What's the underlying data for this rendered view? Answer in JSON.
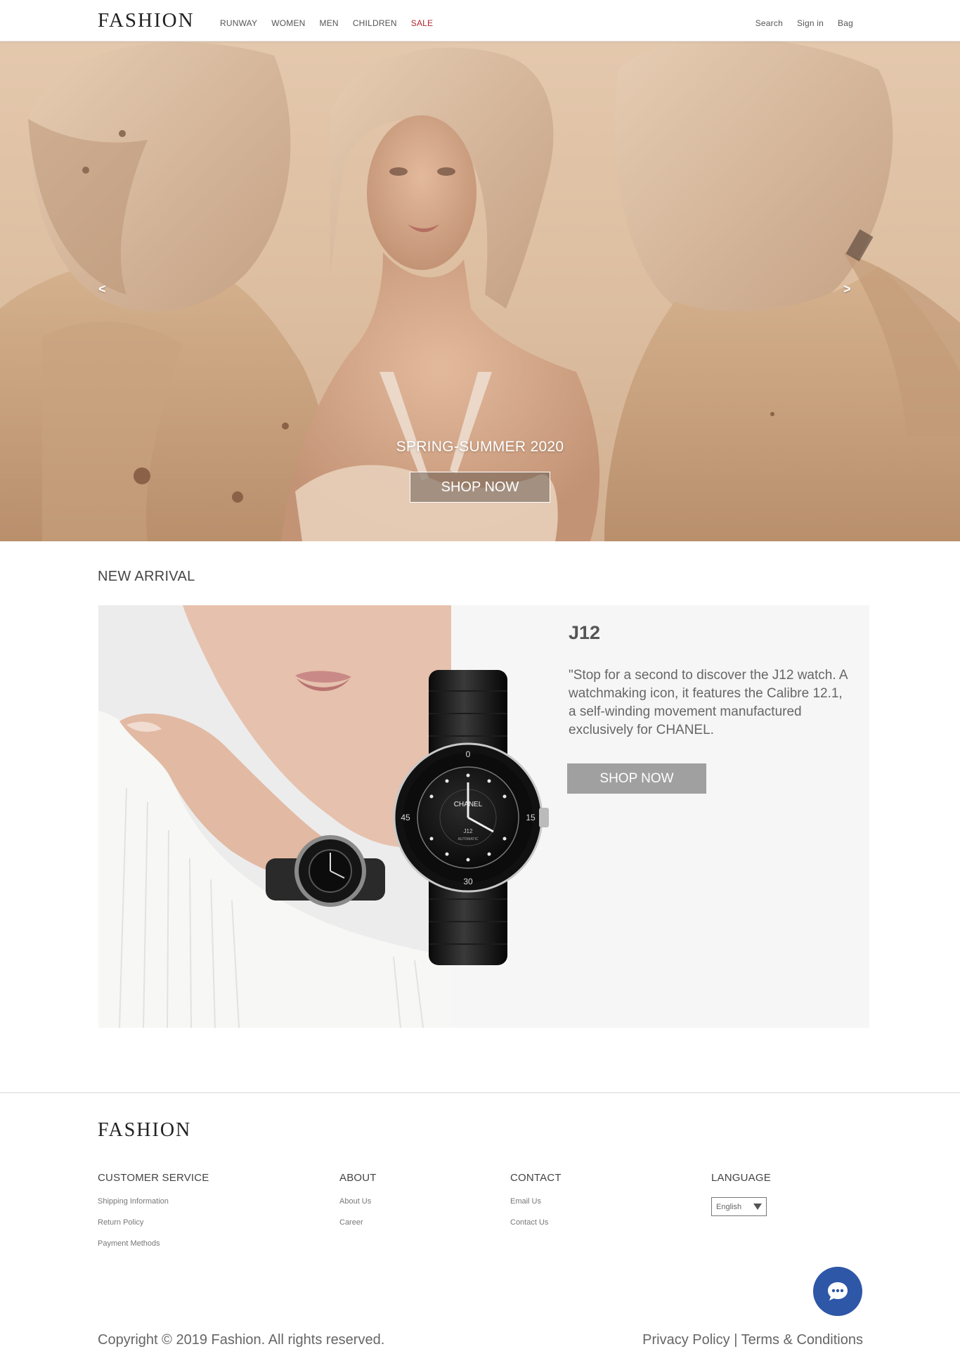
{
  "header": {
    "logo": "FASHION",
    "nav": [
      "RUNWAY",
      "WOMEN",
      "MEN",
      "CHILDREN",
      "SALE"
    ],
    "utility": [
      "Search",
      "Sign in",
      "Bag"
    ]
  },
  "hero": {
    "prev_arrow": "<",
    "next_arrow": ">",
    "title": "SPRING-SUMMER 2020",
    "button": "SHOP NOW"
  },
  "new_arrival": {
    "heading": "NEW ARRIVAL",
    "product_name": "J12",
    "description": "\"Stop for a second to discover the J12 watch. A watchmaking icon, it features the Calibre 12.1, a self-winding movement manufactured exclusively for CHANEL.",
    "button": "SHOP NOW",
    "watch_dial": {
      "brand": "CHANEL",
      "model": "J12",
      "sub": "AUTOMATIC",
      "markers": [
        "0",
        "15",
        "30",
        "45"
      ]
    }
  },
  "footer": {
    "logo": "FASHION",
    "customer_service": {
      "title": "CUSTOMER SERVICE",
      "links": [
        "Shipping Information",
        "Return Policy",
        "Payment Methods"
      ]
    },
    "about": {
      "title": "ABOUT",
      "links": [
        "About Us",
        "Career"
      ]
    },
    "contact": {
      "title": "CONTACT",
      "links": [
        "Email Us",
        "Contact Us"
      ]
    },
    "language": {
      "title": "LANGUAGE",
      "selected": "English"
    },
    "copyright": "Copyright © 2019 Fashion. All rights reserved.",
    "privacy": "Privacy Policy",
    "separator": "|",
    "terms": "Terms & Conditions"
  },
  "colors": {
    "sale": "#b3262e",
    "chat": "#2e57a7",
    "product_button": "#a0a0a0"
  }
}
